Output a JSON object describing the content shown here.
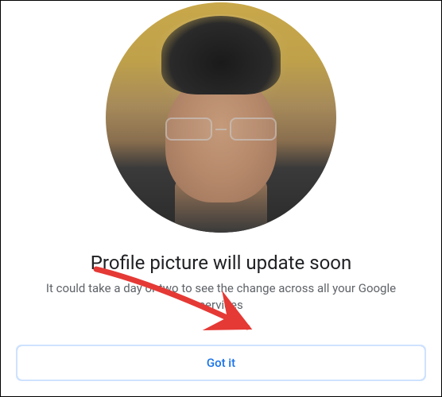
{
  "dialog": {
    "heading": "Profile picture will update soon",
    "subtext": "It could take a day or two to see the change across all your Google services",
    "button_label": "Got it"
  }
}
